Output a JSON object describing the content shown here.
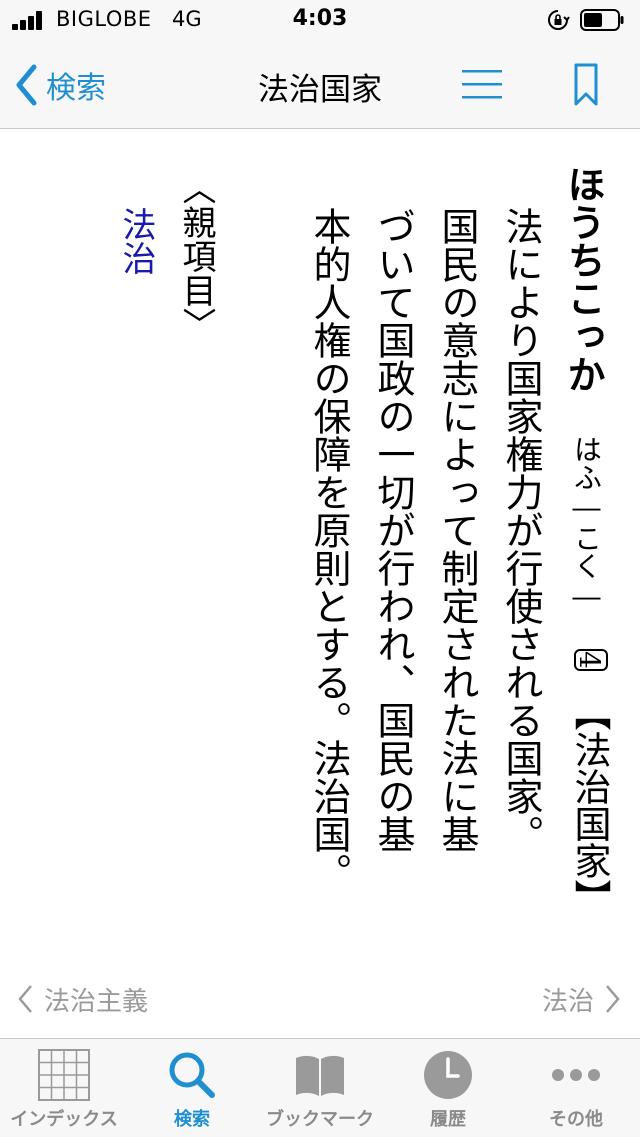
{
  "status": {
    "carrier": "BIGLOBE",
    "network": "4G",
    "time": "4:03"
  },
  "nav": {
    "back_label": "検索",
    "title": "法治国家",
    "icons": {
      "back": "chevron-left-icon",
      "toc": "list-icon",
      "bookmark": "bookmark-icon"
    }
  },
  "entry": {
    "headword": "ほうちこっか",
    "reading": "はふ―こく―",
    "sense_number": "4",
    "sense_term": "【法治国家】",
    "definition_lines": [
      "法により国家権力が行使される国家。",
      "国民の意志によって制定された法に基",
      "づいて国政の一切が行われ、国民の基",
      "本的人権の保障を原則とする。法治国。"
    ],
    "parent_label": "〈親項目〉",
    "parent_link": "法治"
  },
  "pager": {
    "prev_label": "法治主義",
    "next_label": "法治"
  },
  "tabs": [
    {
      "label": "インデックス",
      "icon": "grid-icon",
      "active": false
    },
    {
      "label": "検索",
      "icon": "search-icon",
      "active": true
    },
    {
      "label": "ブックマーク",
      "icon": "book-icon",
      "active": false
    },
    {
      "label": "履歴",
      "icon": "clock-icon",
      "active": false
    },
    {
      "label": "その他",
      "icon": "more-icon",
      "active": false
    }
  ],
  "colors": {
    "accent": "#1f8fd1",
    "link": "#1a1aa8",
    "muted": "#9a9a9a",
    "bar_background": "#f7f7f7"
  }
}
